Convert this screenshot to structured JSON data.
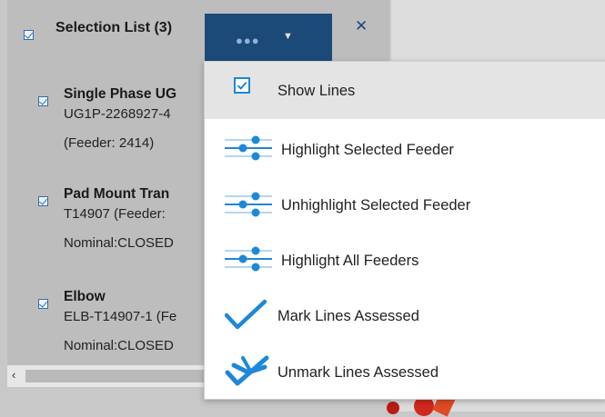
{
  "panel": {
    "title": "Selection List (3)",
    "items": [
      {
        "title": "Single Phase UG",
        "line1": "UG1P-2268927-4",
        "line2": "(Feeder: 2414)"
      },
      {
        "title": "Pad Mount Tran",
        "line1": "T14907 (Feeder:",
        "line2": "Nominal:CLOSED"
      },
      {
        "title": "Elbow",
        "line1": "ELB-T14907-1 (Fe",
        "line2": "Nominal:CLOSED"
      }
    ],
    "menu_toggle_icon": "more-dots-icon",
    "close_icon": "close-icon",
    "scroll_left_glyph": "‹"
  },
  "menu": {
    "items": [
      {
        "label": "Show Lines",
        "icon": "checkbox-checked-icon"
      },
      {
        "label": "Highlight Selected Feeder",
        "icon": "feeder-lines-icon"
      },
      {
        "label": "Unhighlight Selected Feeder",
        "icon": "feeder-lines-icon"
      },
      {
        "label": "Highlight All Feeders",
        "icon": "feeder-lines-icon"
      },
      {
        "label": "Mark Lines Assessed",
        "icon": "checkmark-icon"
      },
      {
        "label": "Unmark Lines Assessed",
        "icon": "uncheck-mark-icon"
      }
    ]
  },
  "colors": {
    "accent": "#1c4a78",
    "icon_blue": "#1e88d8",
    "panel_bg": "#bdbdbd",
    "menu_highlight": "#e4e4e4"
  }
}
